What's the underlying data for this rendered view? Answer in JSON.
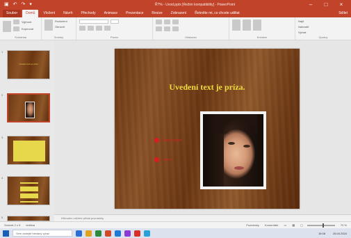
{
  "window": {
    "title": "Ř?% - Uvod.pptx [Režim kompatibility] - PowerPoint",
    "qa_icons": [
      "save-icon",
      "undo-icon",
      "redo-icon",
      "customize-icon"
    ],
    "controls": [
      "minimize",
      "maximize",
      "close"
    ]
  },
  "ribbon": {
    "tabs": [
      "Soubor",
      "Domů",
      "Vložení",
      "Návrh",
      "Přechody",
      "Animace",
      "Prezentace",
      "Revize",
      "Zobrazení",
      "Řekněte mi, co chcete udělat"
    ],
    "active_tab": "Domů",
    "right_labels": [
      "Sdílet"
    ],
    "groups": [
      {
        "label": "Schránka",
        "items": [
          "Vložit",
          "Vyjmout",
          "Kopírovat",
          "Kopírovat formát"
        ]
      },
      {
        "label": "Snímky",
        "items": [
          "Nový snímek",
          "Rozložení",
          "Obnovit",
          "Oddíl"
        ]
      },
      {
        "label": "Písmo",
        "items": []
      },
      {
        "label": "Odstavec",
        "items": []
      },
      {
        "label": "Kreslení",
        "items": []
      },
      {
        "label": "Úpravy",
        "items": [
          "Najít",
          "Nahradit",
          "Vybrat"
        ]
      }
    ]
  },
  "slides_panel": {
    "thumbs": [
      {
        "num": "1",
        "title": "Uvodeni text je priza",
        "selected": false
      },
      {
        "num": "2",
        "title": "",
        "selected": true
      },
      {
        "num": "3",
        "title": "",
        "selected": false
      },
      {
        "num": "4",
        "title": "",
        "selected": false
      },
      {
        "num": "5",
        "title": "",
        "selected": false
      }
    ]
  },
  "slide": {
    "title": "Uvedení text je príza.",
    "bullets": [
      "Lorem ipsum",
      "Lorem"
    ],
    "title_color": "#f0dc40",
    "bullet_color": "#d81e1e"
  },
  "notes": {
    "placeholder": "Kliknutím můžete přidat poznámky"
  },
  "statusbar": {
    "slide_info": "Snímek 2 z 5",
    "language": "čeština",
    "notes": "Poznámky",
    "comments": "Komentáře",
    "zoom": "70 %"
  },
  "taskbar": {
    "search_placeholder": "Sem zadejte hledaný výraz",
    "apps": [
      "#2a6ed6",
      "#e0a31f",
      "#2b8a3e",
      "#d04a2a",
      "#1f7ad6",
      "#8a3bd6",
      "#d8312a",
      "#2aa0d6"
    ],
    "time": "15:08",
    "date": "26.04.2024"
  }
}
